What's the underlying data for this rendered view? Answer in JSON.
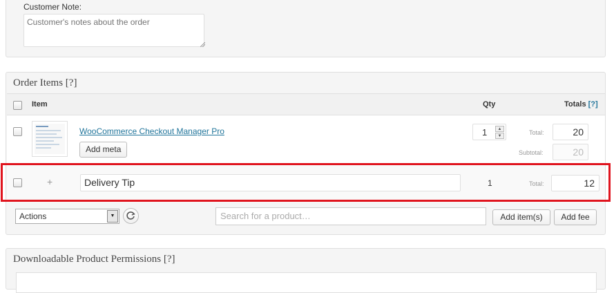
{
  "customer_note": {
    "label": "Customer Note:",
    "placeholder": "Customer's notes about the order"
  },
  "order_items": {
    "title": "Order Items [?]",
    "columns": {
      "item": "Item",
      "qty": "Qty",
      "totals": "Totals",
      "totals_help": "[?]"
    },
    "rows": [
      {
        "name": "WooCommerce Checkout Manager Pro",
        "add_meta_label": "Add meta",
        "qty": "1",
        "total_label": "Total:",
        "total": "20",
        "subtotal_label": "Subtotal:",
        "subtotal": "20"
      },
      {
        "plus": "+",
        "name": "Delivery Tip",
        "qty": "1",
        "total_label": "Total:",
        "total": "12"
      }
    ],
    "actions": {
      "select_value": "Actions",
      "search_placeholder": "Search for a product…",
      "add_items_label": "Add item(s)",
      "add_fee_label": "Add fee"
    }
  },
  "downloadable": {
    "title": "Downloadable Product Permissions [?]"
  },
  "colors": {
    "highlight": "#e0141e",
    "link": "#21759b"
  }
}
